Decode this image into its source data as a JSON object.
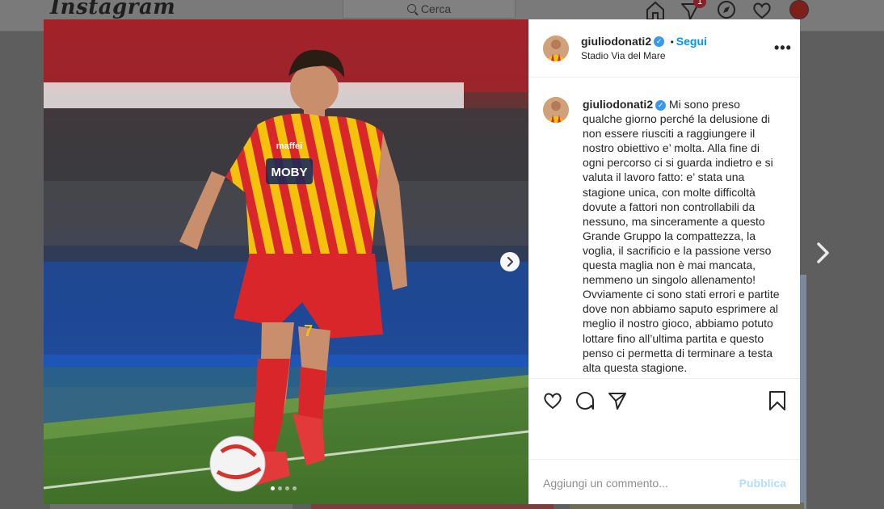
{
  "app": {
    "logo": "Instagram"
  },
  "search": {
    "placeholder": "Cerca"
  },
  "nav": {
    "activity_badge": "1"
  },
  "post": {
    "username": "giuliodonati2",
    "verified_mark": "✓",
    "separator": "•",
    "follow_label": "Segui",
    "location": "Stadio Via del Mare",
    "more_label": "•••",
    "caption": "Mi sono preso qualche giorno perché la delusione di non essere riusciti a raggiungere il nostro obiettivo e’ molta. Alla fine di ogni percorso ci si guarda indietro e si valuta il lavoro fatto: e’ stata una stagione unica, con molte difficoltà dovute a fattori non controllabili da nessuno, ma sinceramente a questo Grande Gruppo la compattezza, la voglia, il sacrificio e la passione verso questa maglia non è mai mancata, nemmeno un singolo allenamento! Ovviamente ci sono stati errori e partite dove non abbiamo saputo esprimere al meglio il nostro gioco, abbiamo potuto lottare fino all’ultima partita e questo penso ci permetta di terminare a testa alta questa stagione.",
    "carousel": {
      "current": 1,
      "total": 4
    },
    "photo_text": {
      "jersey_sponsor": "MOBY",
      "jersey_sponsor_top": "maffei",
      "shorts_number": "7"
    }
  },
  "comment_box": {
    "placeholder": "Aggiungi un commento...",
    "publish_label": "Pubblica"
  },
  "colors": {
    "accent": "#0095f6",
    "publish_disabled": "#b2dffc",
    "jersey_red": "#d9262b",
    "jersey_yellow": "#f4c20d"
  },
  "icons": [
    "home-icon",
    "activity-icon",
    "explore-icon",
    "heart-icon",
    "like-icon",
    "comment-icon",
    "share-icon",
    "save-icon",
    "chevron-right-icon"
  ]
}
